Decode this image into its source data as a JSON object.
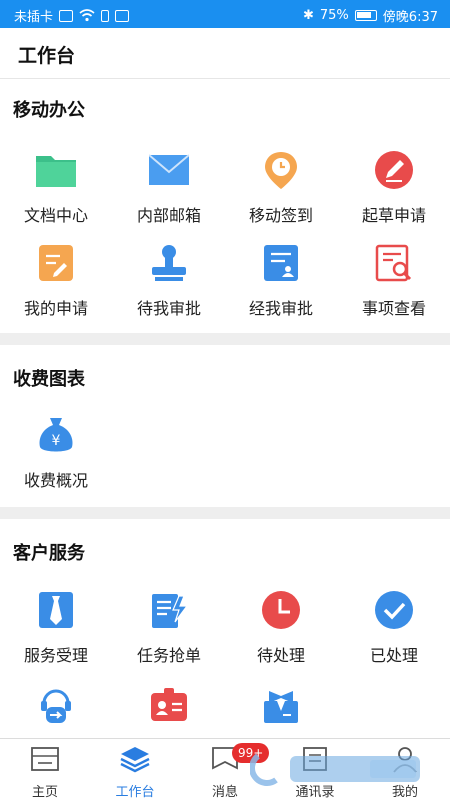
{
  "status_bar": {
    "carrier": "未插卡",
    "battery_percent": "75%",
    "time": "傍晚6:37"
  },
  "header": {
    "title": "工作台"
  },
  "sections": [
    {
      "title": "移动办公",
      "items": [
        {
          "label": "文档中心",
          "icon": "folder-icon"
        },
        {
          "label": "内部邮箱",
          "icon": "mail-icon"
        },
        {
          "label": "移动签到",
          "icon": "location-clock-icon"
        },
        {
          "label": "起草申请",
          "icon": "pen-icon"
        },
        {
          "label": "我的申请",
          "icon": "edit-document-icon"
        },
        {
          "label": "待我审批",
          "icon": "stamp-icon"
        },
        {
          "label": "经我审批",
          "icon": "document-user-icon"
        },
        {
          "label": "事项查看",
          "icon": "document-search-icon"
        }
      ]
    },
    {
      "title": "收费图表",
      "items": [
        {
          "label": "收费概况",
          "icon": "money-bag-icon"
        }
      ]
    },
    {
      "title": "客户服务",
      "items": [
        {
          "label": "服务受理",
          "icon": "tie-icon"
        },
        {
          "label": "任务抢单",
          "icon": "task-grab-icon"
        },
        {
          "label": "待处理",
          "icon": "clock-icon"
        },
        {
          "label": "已处理",
          "icon": "check-circle-icon"
        },
        {
          "label": "",
          "icon": "headset-icon"
        },
        {
          "label": "",
          "icon": "id-card-icon"
        },
        {
          "label": "",
          "icon": "staff-icon"
        }
      ]
    }
  ],
  "tab_bar": {
    "tabs": [
      {
        "label": "主页",
        "icon": "home-icon",
        "active": false
      },
      {
        "label": "工作台",
        "icon": "layers-icon",
        "active": true
      },
      {
        "label": "消息",
        "icon": "message-icon",
        "active": false
      },
      {
        "label": "通讯录",
        "icon": "contacts-icon",
        "active": false
      },
      {
        "label": "我的",
        "icon": "profile-icon",
        "active": false
      }
    ],
    "message_badge": "99+"
  },
  "colors": {
    "status_bar_bg": "#1a8ff0",
    "accent": "#2a7de0"
  }
}
